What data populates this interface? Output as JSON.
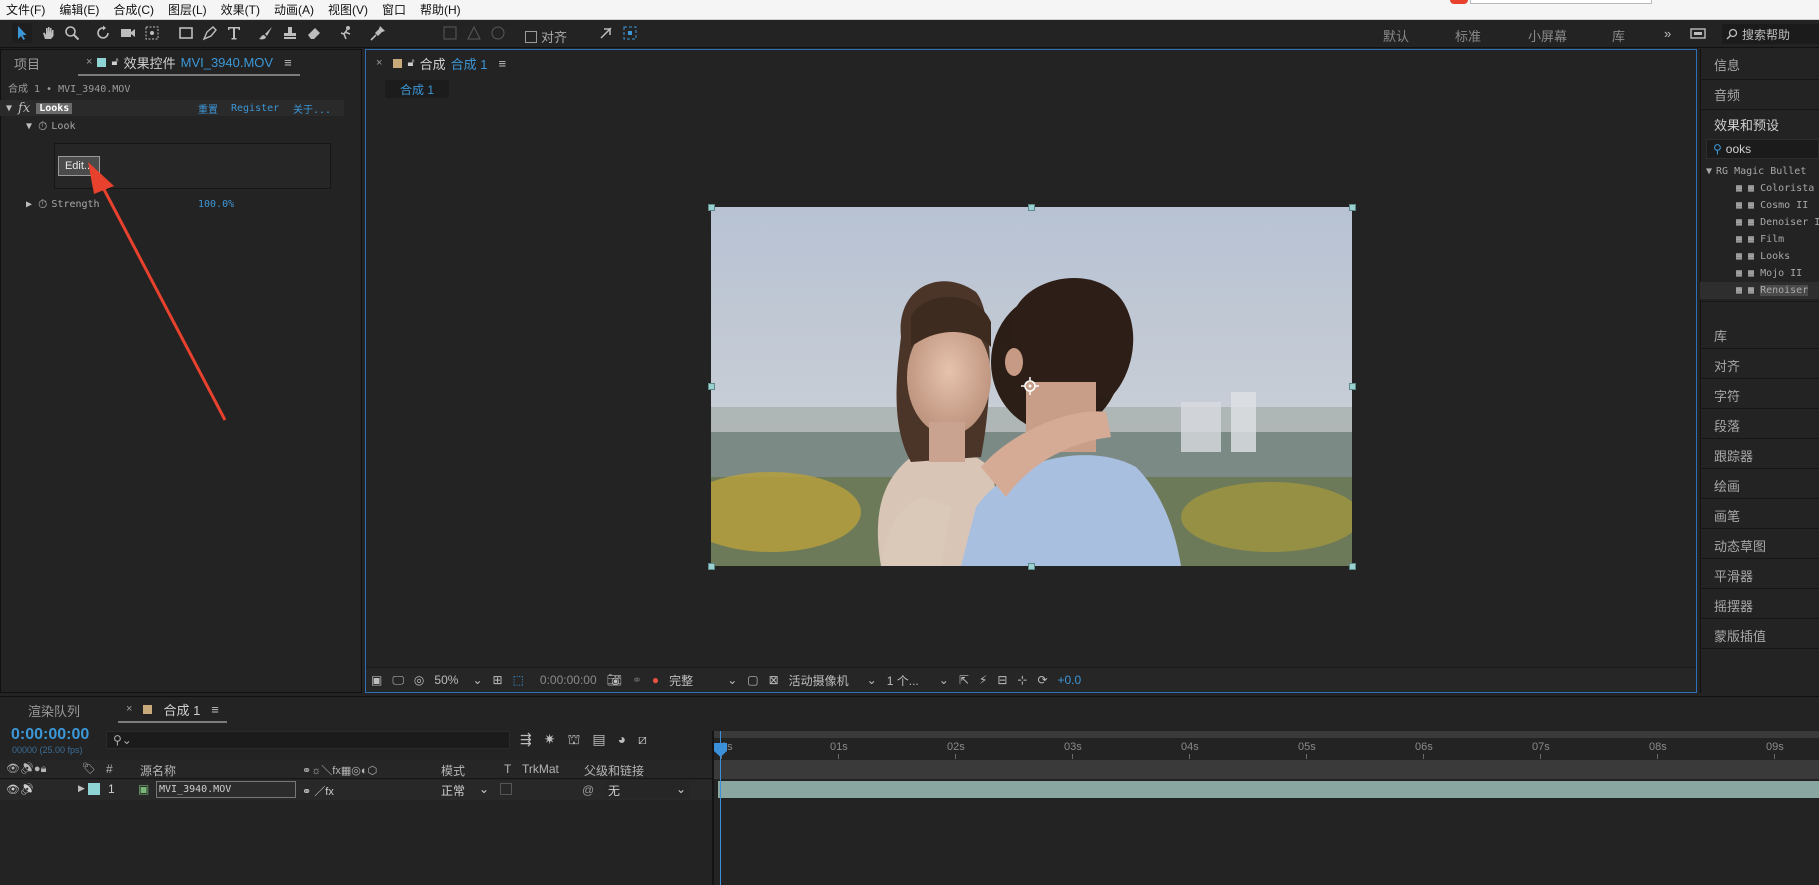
{
  "menu": [
    "文件(F)",
    "编辑(E)",
    "合成(C)",
    "图层(L)",
    "效果(T)",
    "动画(A)",
    "视图(V)",
    "窗口",
    "帮助(H)"
  ],
  "toolbar": {
    "align_label": "对齐",
    "workspaces": [
      "默认",
      "标准",
      "小屏幕",
      "库"
    ],
    "search_help": "搜索帮助"
  },
  "left_panel": {
    "tabs": [
      "项目",
      "效果控件 MVI_3940.MOV"
    ],
    "tab_name_prefix": "效果控件",
    "tab_name_file": "MVI_3940.MOV",
    "header": "合成 1 • MVI_3940.MOV",
    "effect_name": "Looks",
    "effect_links": [
      "重置",
      "Register",
      "关于..."
    ],
    "look_label": "Look",
    "edit_button": "Edit...",
    "strength_label": "Strength",
    "strength_value": "100.0%"
  },
  "viewer": {
    "tab_prefix": "合成",
    "tab_name": "合成 1",
    "comp_pill": "合成 1",
    "zoom": "50%",
    "timecode": "0:00:00:00",
    "resolution": "完整",
    "camera": "活动摄像机",
    "views": "1 个...",
    "exposure": "+0.0"
  },
  "right_panel": {
    "top_items": [
      "信息",
      "音频",
      "效果和预设"
    ],
    "search_value": "ooks",
    "category": "RG Magic Bullet",
    "effects": [
      "Colorista",
      "Cosmo II",
      "Denoiser III",
      "Film",
      "Looks",
      "Mojo II",
      "Renoiser"
    ],
    "bottom_items": [
      "库",
      "对齐",
      "字符",
      "段落",
      "跟踪器",
      "绘画",
      "画笔",
      "动态草图",
      "平滑器",
      "摇摆器",
      "蒙版插值"
    ]
  },
  "timeline": {
    "tabs": [
      "渲染队列",
      "合成 1"
    ],
    "timecode": "0:00:00:00",
    "fps": "00000 (25.00 fps)",
    "columns": {
      "num": "#",
      "source": "源名称",
      "mode": "模式",
      "t": "T",
      "trkmat": "TrkMat",
      "parent": "父级和链接"
    },
    "layer": {
      "index": "1",
      "name": "MVI_3940.MOV",
      "mode": "正常",
      "parent": "无"
    },
    "ticks": [
      "0s",
      "01s",
      "02s",
      "03s",
      "04s",
      "05s",
      "06s",
      "07s",
      "08s",
      "09s"
    ]
  },
  "colors": {
    "accent": "#3c97d7",
    "panel": "#232323",
    "annotation_arrow": "#e8412d",
    "layer_bar": "#8aa6a0"
  }
}
